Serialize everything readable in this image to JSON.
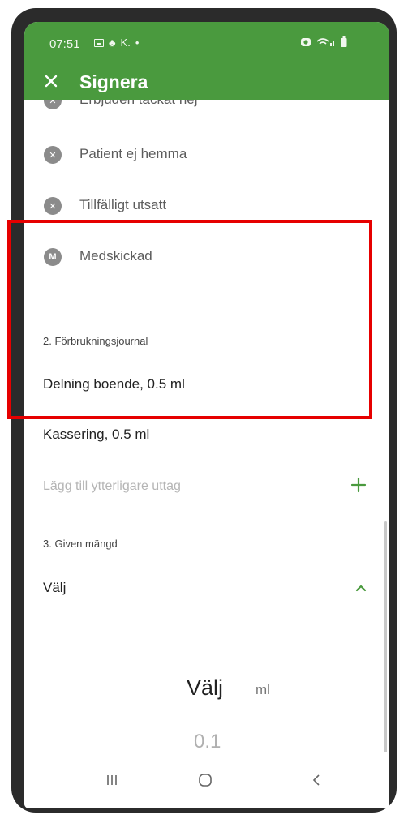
{
  "status_bar": {
    "time": "07:51",
    "notifications": "K.",
    "dot": "•"
  },
  "app_bar": {
    "title": "Signera"
  },
  "options": [
    {
      "label": "Erbjuden tackat nej",
      "icon": "x-circle-icon",
      "glyph": "✕"
    },
    {
      "label": "Patient ej hemma",
      "icon": "x-circle-icon",
      "glyph": "✕"
    },
    {
      "label": "Tillfälligt utsatt",
      "icon": "x-circle-icon",
      "glyph": "✕"
    },
    {
      "label": "Medskickad",
      "icon": "m-circle-icon",
      "glyph": "M"
    }
  ],
  "journal": {
    "heading": "2. Förbrukningsjournal",
    "items": [
      "Delning boende, 0.5 ml",
      "Kassering, 0.5 ml"
    ],
    "add_placeholder": "Lägg till ytterligare uttag"
  },
  "dose": {
    "heading": "3. Given mängd",
    "selected": "Välj",
    "picker_value": "Välj",
    "picker_unit": "ml",
    "picker_next": "0.1"
  },
  "colors": {
    "accent": "#4a9a3e",
    "highlight": "#e60000",
    "icon_grey": "#8b8b8b"
  }
}
